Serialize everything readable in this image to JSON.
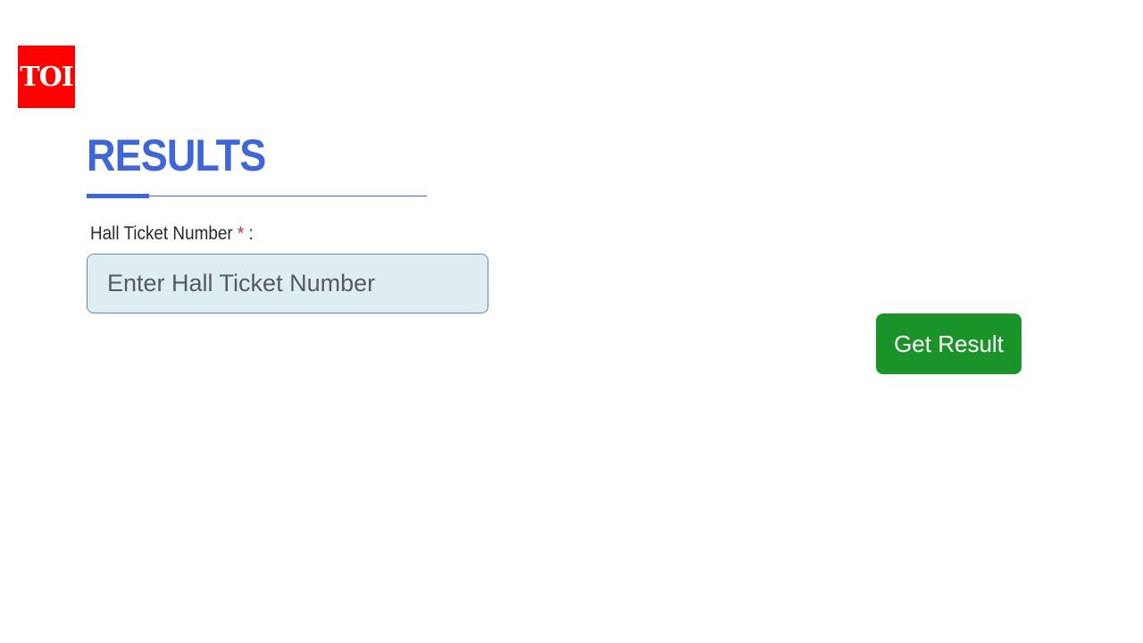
{
  "logo": {
    "text": "TOI",
    "color": "#ff0000"
  },
  "form": {
    "title": "RESULTS",
    "title_color": "#3e66d6",
    "field_label": "Hall Ticket Number",
    "required_marker": "*",
    "label_suffix": ":",
    "ticket_input": {
      "value": "",
      "placeholder": "Enter Hall Ticket Number"
    },
    "submit_label": "Get Result",
    "submit_color": "#1a9328"
  }
}
